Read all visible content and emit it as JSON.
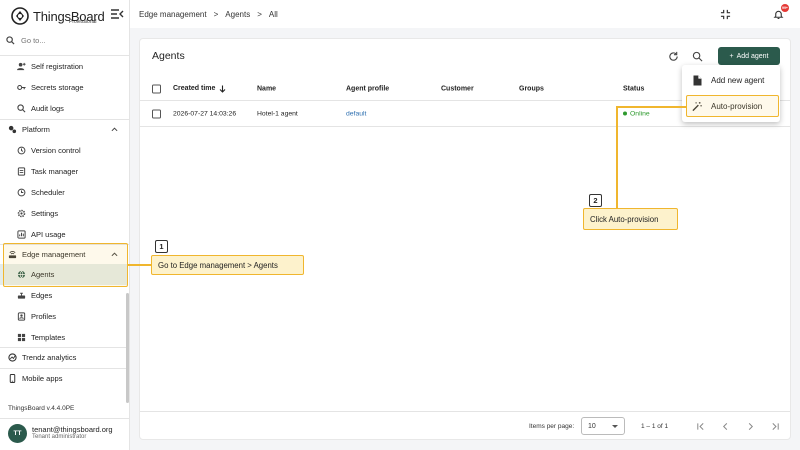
{
  "brand": {
    "name": "ThingsBoard",
    "edition": "Professional"
  },
  "search": {
    "placeholder": "Go to..."
  },
  "sidebar": {
    "items": [
      {
        "label": "Self registration",
        "icon": "user-add-icon"
      },
      {
        "label": "Secrets storage",
        "icon": "key-icon"
      },
      {
        "label": "Audit logs",
        "icon": "audit-icon"
      },
      {
        "label": "Platform",
        "icon": "platform-icon"
      },
      {
        "label": "Version control",
        "icon": "history-icon"
      },
      {
        "label": "Task manager",
        "icon": "tasks-icon"
      },
      {
        "label": "Scheduler",
        "icon": "clock-icon"
      },
      {
        "label": "Settings",
        "icon": "gear-icon"
      },
      {
        "label": "API usage",
        "icon": "api-icon"
      },
      {
        "label": "Edge management",
        "icon": "router-icon"
      },
      {
        "label": "Agents",
        "icon": "globe-icon"
      },
      {
        "label": "Edges",
        "icon": "edge-icon"
      },
      {
        "label": "Profiles",
        "icon": "profile-icon"
      },
      {
        "label": "Templates",
        "icon": "grid-icon"
      },
      {
        "label": "Trendz analytics",
        "icon": "trendz-icon"
      },
      {
        "label": "Mobile apps",
        "icon": "phone-icon"
      }
    ],
    "version": "ThingsBoard v.4.4.0PE",
    "user": {
      "initials": "TT",
      "email": "tenant@thingsboard.org",
      "role": "Tenant administrator"
    }
  },
  "header": {
    "breadcrumb": [
      "Edge management",
      ">",
      "Agents",
      ">",
      "All"
    ],
    "notification_count": "99+"
  },
  "main": {
    "title": "Agents",
    "add_button": "Add agent",
    "columns": [
      "Created time",
      "Name",
      "Agent profile",
      "Customer",
      "Groups",
      "Status"
    ],
    "rows": [
      {
        "created": "2026-07-27 14:03:26",
        "name": "Hotel-1 agent",
        "profile": "default",
        "customer": "",
        "groups": "",
        "status": "Online"
      }
    ],
    "pagination": {
      "items_per_page_label": "Items per page:",
      "items_per_page": "10",
      "range": "1 – 1 of 1"
    }
  },
  "menu": {
    "items": [
      "Add new agent",
      "Auto-provision"
    ]
  },
  "callouts": [
    {
      "number": "1",
      "text": "Go to Edge management > Agents"
    },
    {
      "number": "2",
      "text": "Click Auto-provision"
    }
  ],
  "colors": {
    "primary": "#2b5a4c",
    "highlight": "#f0b62e",
    "note_bg": "#fdf2cc",
    "link": "#2e6fb0",
    "online": "#2e9a2e"
  }
}
